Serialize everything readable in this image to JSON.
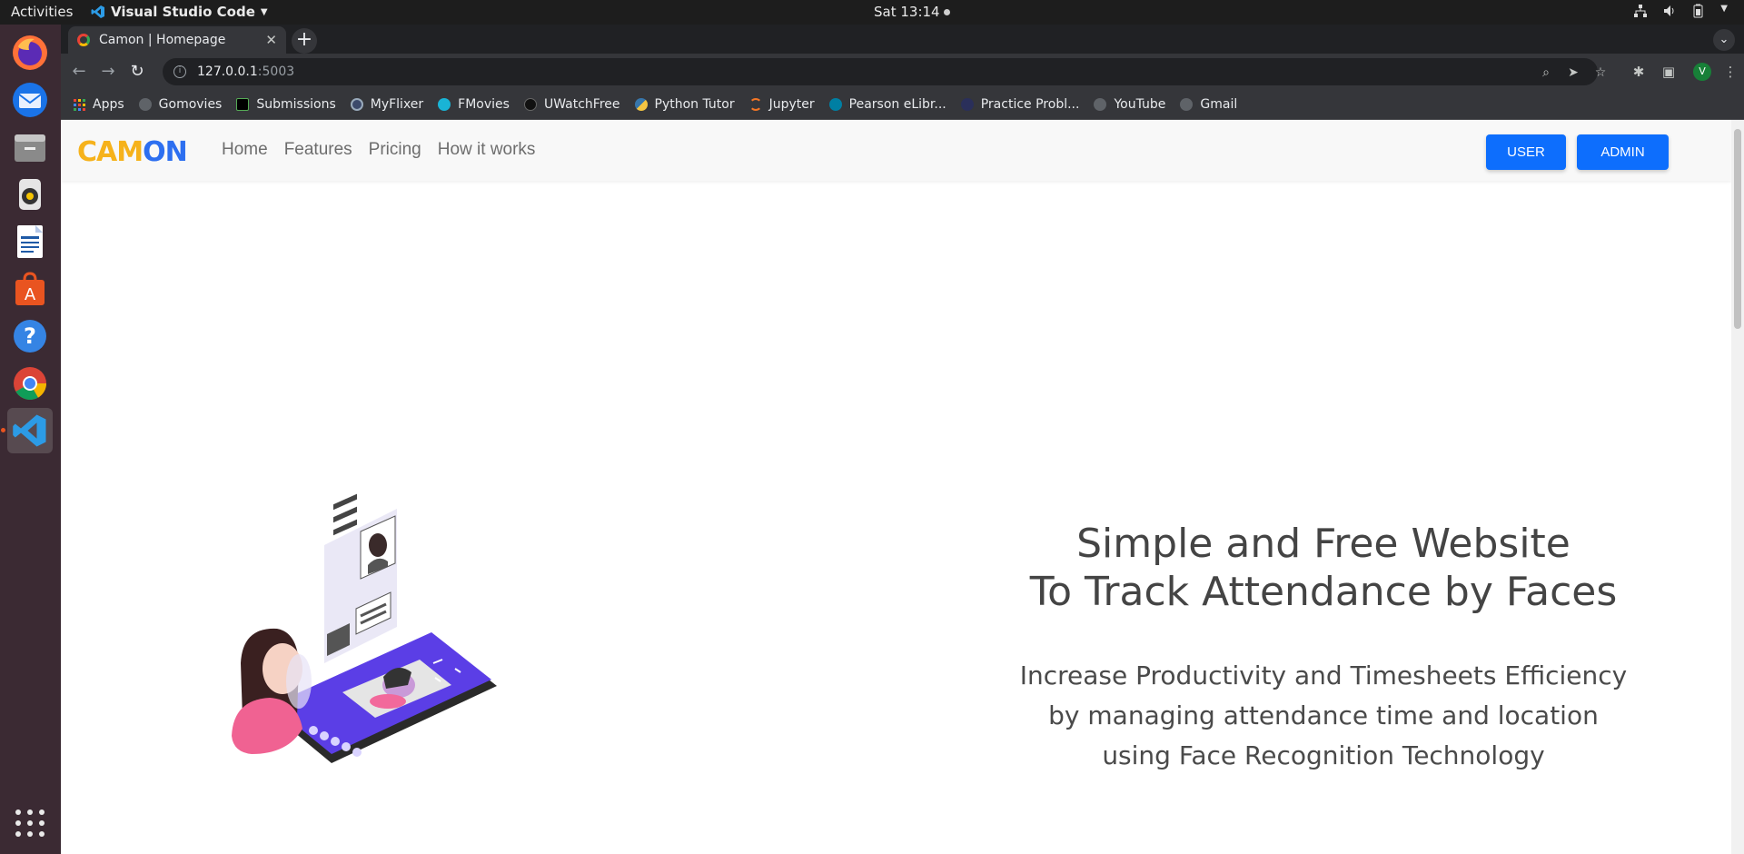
{
  "system": {
    "activities": "Activities",
    "app_name": "Visual Studio Code",
    "clock": "Sat 13:14"
  },
  "browser": {
    "tab_title": "Camon | Homepage",
    "url_host": "127.0.0.1",
    "url_port": ":5003",
    "profile_initial": "V",
    "bookmarks": [
      {
        "label": "Apps",
        "color": "#4285f4"
      },
      {
        "label": "Gomovies",
        "color": "#5f6368"
      },
      {
        "label": "Submissions",
        "color": "#000000"
      },
      {
        "label": "MyFlixer",
        "color": "#3c4a6b"
      },
      {
        "label": "FMovies",
        "color": "#19b4d6"
      },
      {
        "label": "UWatchFree",
        "color": "#111111"
      },
      {
        "label": "Python Tutor",
        "color": "#f4c542"
      },
      {
        "label": "Jupyter",
        "color": "#f37626"
      },
      {
        "label": "Pearson eLibr...",
        "color": "#007fa3"
      },
      {
        "label": "Practice Probl...",
        "color": "#2a2f5a"
      },
      {
        "label": "YouTube",
        "color": "#5f6368"
      },
      {
        "label": "Gmail",
        "color": "#5f6368"
      }
    ]
  },
  "site": {
    "logo_part1": "CAM",
    "logo_part2": "ON",
    "nav": [
      "Home",
      "Features",
      "Pricing",
      "How it works"
    ],
    "user_button": "USER",
    "admin_button": "ADMIN",
    "hero_title_line1": "Simple and Free Website",
    "hero_title_line2": "To Track Attendance by Faces",
    "hero_sub_line1": "Increase Productivity and Timesheets Efficiency",
    "hero_sub_line2": "by managing attendance time and location",
    "hero_sub_line3": "using Face Recognition Technology",
    "accent_color": "#0d6efd"
  }
}
